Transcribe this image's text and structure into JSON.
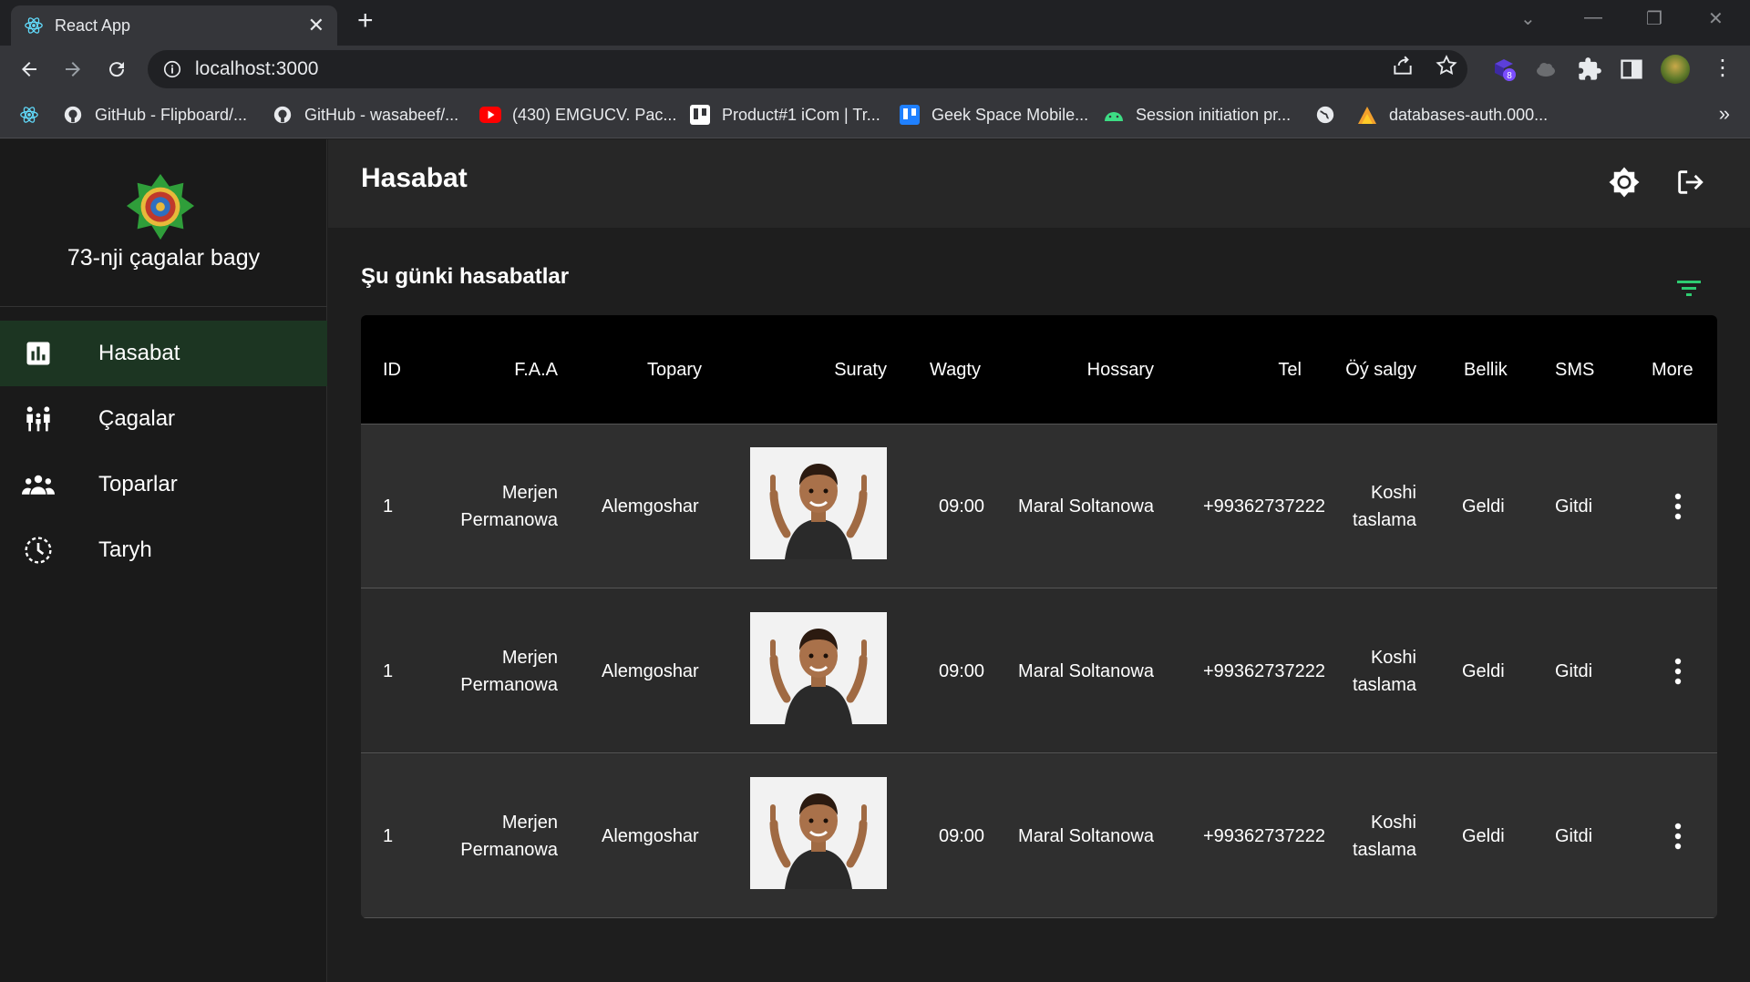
{
  "browser": {
    "tab_title": "React App",
    "url": "localhost:3000",
    "extension_badge": "8",
    "bookmarks": [
      {
        "icon": "react-icon",
        "label": ""
      },
      {
        "icon": "github-icon",
        "label": "GitHub - Flipboard/..."
      },
      {
        "icon": "github-icon",
        "label": "GitHub - wasabeef/..."
      },
      {
        "icon": "youtube-icon",
        "label": "(430) EMGUCV. Pac..."
      },
      {
        "icon": "trello-icon",
        "label": "Product#1 iCom | Tr..."
      },
      {
        "icon": "trello-blue-icon",
        "label": "Geek Space Mobile..."
      },
      {
        "icon": "android-icon",
        "label": "Session initiation pr..."
      },
      {
        "icon": "globe-icon",
        "label": ""
      },
      {
        "icon": "firebase-icon",
        "label": "databases-auth.000..."
      }
    ],
    "bookmarks_more": "»"
  },
  "sidebar": {
    "brand_name": "73-nji çagalar bagy",
    "items": [
      {
        "label": "Hasabat",
        "icon": "chart-icon",
        "active": true
      },
      {
        "label": "Çagalar",
        "icon": "family-icon",
        "active": false
      },
      {
        "label": "Toparlar",
        "icon": "group-icon",
        "active": false
      },
      {
        "label": "Taryh",
        "icon": "history-icon",
        "active": false
      }
    ]
  },
  "header": {
    "title": "Hasabat",
    "theme_icon": "brightness-icon",
    "logout_icon": "logout-icon"
  },
  "main": {
    "section_title": "Şu günki hasabatlar",
    "filter_color": "#2ecc71",
    "columns": [
      "ID",
      "F.A.A",
      "Topary",
      "Suraty",
      "Wagty",
      "Hossary",
      "Tel",
      "Öý salgy",
      "Bellik",
      "SMS",
      "More"
    ],
    "rows": [
      {
        "id": "1",
        "name": "Merjen Permanowa",
        "group": "Alemgoshar",
        "time": "09:00",
        "guardian": "Maral Soltanowa",
        "phone": "+99362737222",
        "address": "Koshi taslama",
        "note": "Geldi",
        "sms": "Gitdi"
      },
      {
        "id": "1",
        "name": "Merjen Permanowa",
        "group": "Alemgoshar",
        "time": "09:00",
        "guardian": "Maral Soltanowa",
        "phone": "+99362737222",
        "address": "Koshi taslama",
        "note": "Geldi",
        "sms": "Gitdi"
      },
      {
        "id": "1",
        "name": "Merjen Permanowa",
        "group": "Alemgoshar",
        "time": "09:00",
        "guardian": "Maral Soltanowa",
        "phone": "+99362737222",
        "address": "Koshi taslama",
        "note": "Geldi",
        "sms": "Gitdi"
      }
    ]
  },
  "colors": {
    "active_nav": "#1c3522",
    "table_header": "#000000",
    "accent": "#2ecc71"
  }
}
